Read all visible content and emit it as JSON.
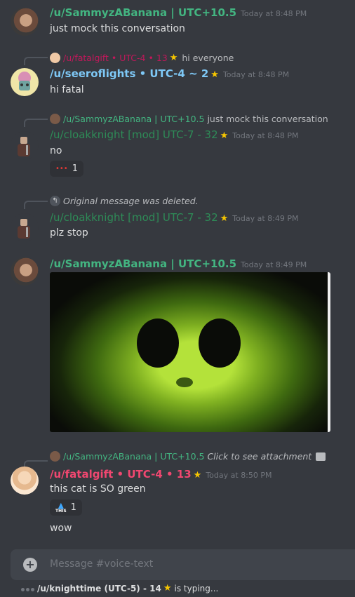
{
  "colors": {
    "sammy": "#43b581",
    "seer": "#7ec8f6",
    "fatal": "#f04770",
    "fatal_reply": "#c2185b",
    "cloak": "#2e8b57",
    "deleted": "#b9bbbe"
  },
  "messages": [
    {
      "author": "/u/SammyzABanana | UTC+10.5",
      "timestamp": "Today at 8:48 PM",
      "text": "just mock this conversation"
    },
    {
      "reply_author": "/u/fatalgift • UTC-4 • 13",
      "reply_text": "hi everyone",
      "author": "/u/seeroflights • UTC-4 ~ 2",
      "timestamp": "Today at 8:48 PM",
      "text": "hi fatal"
    },
    {
      "reply_author": "/u/SammyzABanana | UTC+10.5",
      "reply_text": "just mock this conversation",
      "author": "/u/cloakknight [mod] UTC-7 - 32",
      "timestamp": "Today at 8:48 PM",
      "text": "no",
      "reaction_count": "1"
    },
    {
      "reply_text": "Original message was deleted.",
      "author": "/u/cloakknight [mod] UTC-7 - 32",
      "timestamp": "Today at 8:49 PM",
      "text": "plz stop"
    },
    {
      "author": "/u/SammyzABanana | UTC+10.5",
      "timestamp": "Today at 8:49 PM",
      "image_icon": "green-cat-image"
    },
    {
      "reply_author": "/u/SammyzABanana | UTC+10.5",
      "reply_text": "Click to see attachment",
      "author": "/u/fatalgift • UTC-4 • 13",
      "timestamp": "Today at 8:50 PM",
      "text": "this cat is SO green",
      "reaction_label": "THIS",
      "reaction_count": "1",
      "text2": "wow"
    }
  ],
  "composer": {
    "placeholder": "Message #voice-text"
  },
  "typing": {
    "user": "/u/knighttime (UTC-5) - 14",
    "suffix": "is typing..."
  }
}
